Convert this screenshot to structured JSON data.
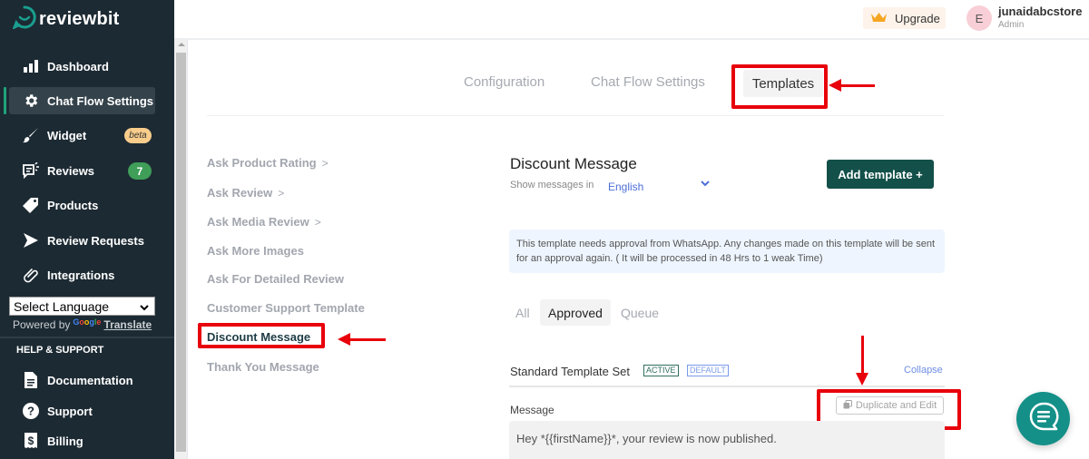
{
  "app": {
    "name": "reviewbit"
  },
  "sidebar": {
    "items": [
      {
        "label": "Dashboard",
        "icon": "bar-chart-icon"
      },
      {
        "label": "Chat Flow Settings",
        "icon": "gear-icon",
        "active": true
      },
      {
        "label": "Widget",
        "icon": "brush-icon",
        "badge": "beta"
      },
      {
        "label": "Reviews",
        "icon": "reviews-icon",
        "badge": "7"
      },
      {
        "label": "Products",
        "icon": "tag-icon"
      },
      {
        "label": "Review Requests",
        "icon": "send-icon"
      },
      {
        "label": "Integrations",
        "icon": "paperclip-icon"
      }
    ],
    "language_select": {
      "value": "Select Language"
    },
    "powered_by": "Powered by",
    "google": "Google",
    "translate": "Translate",
    "help_title": "HELP & SUPPORT",
    "help_items": [
      {
        "label": "Documentation",
        "icon": "document-icon"
      },
      {
        "label": "Support",
        "icon": "question-icon"
      },
      {
        "label": "Billing",
        "icon": "billing-icon"
      }
    ]
  },
  "header": {
    "upgrade_label": "Upgrade",
    "avatar_initial": "E",
    "user_name": "junaidabcstore",
    "user_role": "Admin"
  },
  "tabs": [
    {
      "label": "Configuration"
    },
    {
      "label": "Chat Flow Settings"
    },
    {
      "label": "Templates",
      "active": true
    }
  ],
  "template_list": [
    {
      "label": "Ask Product Rating",
      "has_chevron": true
    },
    {
      "label": "Ask Review",
      "has_chevron": true
    },
    {
      "label": "Ask Media Review",
      "has_chevron": true
    },
    {
      "label": "Ask More Images"
    },
    {
      "label": "Ask For Detailed Review"
    },
    {
      "label": "Customer Support Template"
    },
    {
      "label": "Discount Message",
      "selected": true
    },
    {
      "label": "Thank You Message"
    }
  ],
  "main": {
    "title": "Discount Message",
    "show_messages_in": "Show messages in",
    "language": "English",
    "add_template_label": "Add template +",
    "notice": "This template needs approval from WhatsApp. Any changes made on this template will be sent for an approval again. ( It will be processed in 48 Hrs to 1 weak Time)",
    "filter_tabs": [
      {
        "label": "All"
      },
      {
        "label": "Approved",
        "active": true
      },
      {
        "label": "Queue"
      }
    ],
    "template_set": {
      "title": "Standard Template Set",
      "tag_active": "ACTIVE",
      "tag_default": "DEFAULT",
      "collapse_label": "Collapse",
      "message_label": "Message",
      "duplicate_label": "Duplicate and Edit",
      "message_text": "Hey *{{firstName}}*, your review is now published."
    }
  },
  "colors": {
    "sidebar_bg": "#1c2a33",
    "accent_green": "#135049",
    "active_indicator": "#1fa37a",
    "annotation_red": "#e8000b",
    "link_blue": "#4e6fd8",
    "chat_fab": "#149088"
  }
}
